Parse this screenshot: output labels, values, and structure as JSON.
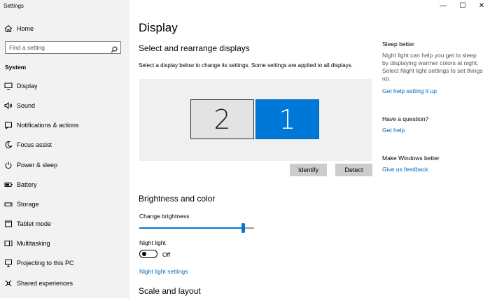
{
  "window": {
    "title": "Settings",
    "controls": {
      "minimize": "—",
      "maximize": "☐",
      "close": "✕"
    }
  },
  "sidebar": {
    "home_label": "Home",
    "search_placeholder": "Find a setting",
    "section_label": "System",
    "items": [
      {
        "label": "Display",
        "icon": "monitor-icon"
      },
      {
        "label": "Sound",
        "icon": "speaker-icon"
      },
      {
        "label": "Notifications & actions",
        "icon": "notification-icon"
      },
      {
        "label": "Focus assist",
        "icon": "moon-icon"
      },
      {
        "label": "Power & sleep",
        "icon": "power-icon"
      },
      {
        "label": "Battery",
        "icon": "battery-icon"
      },
      {
        "label": "Storage",
        "icon": "storage-icon"
      },
      {
        "label": "Tablet mode",
        "icon": "tablet-icon"
      },
      {
        "label": "Multitasking",
        "icon": "multitasking-icon"
      },
      {
        "label": "Projecting to this PC",
        "icon": "projector-icon"
      },
      {
        "label": "Shared experiences",
        "icon": "shared-icon"
      }
    ]
  },
  "main": {
    "title": "Display",
    "arrange": {
      "heading": "Select and rearrange displays",
      "description": "Select a display below to change its settings. Some settings are applied to all displays.",
      "monitors": [
        "2",
        "1"
      ],
      "identify_label": "Identify",
      "detect_label": "Detect"
    },
    "brightness": {
      "heading": "Brightness and color",
      "slider_label": "Change brightness",
      "brightness_value": 0.9,
      "night_light_label": "Night light",
      "night_light_state": "Off",
      "night_light_settings_link": "Night light settings"
    },
    "scale_heading": "Scale and layout"
  },
  "right": {
    "sleep": {
      "heading": "Sleep better",
      "text": "Night light can help you get to sleep by displaying warmer colors at night. Select Night light settings to set things up.",
      "link": "Get help setting it up"
    },
    "question": {
      "heading": "Have a question?",
      "link": "Get help"
    },
    "feedback": {
      "heading": "Make Windows better",
      "link": "Give us feedback"
    }
  },
  "colors": {
    "accent": "#0078d7",
    "link": "#0067b8",
    "sidebar_bg": "#f2f2f2"
  }
}
